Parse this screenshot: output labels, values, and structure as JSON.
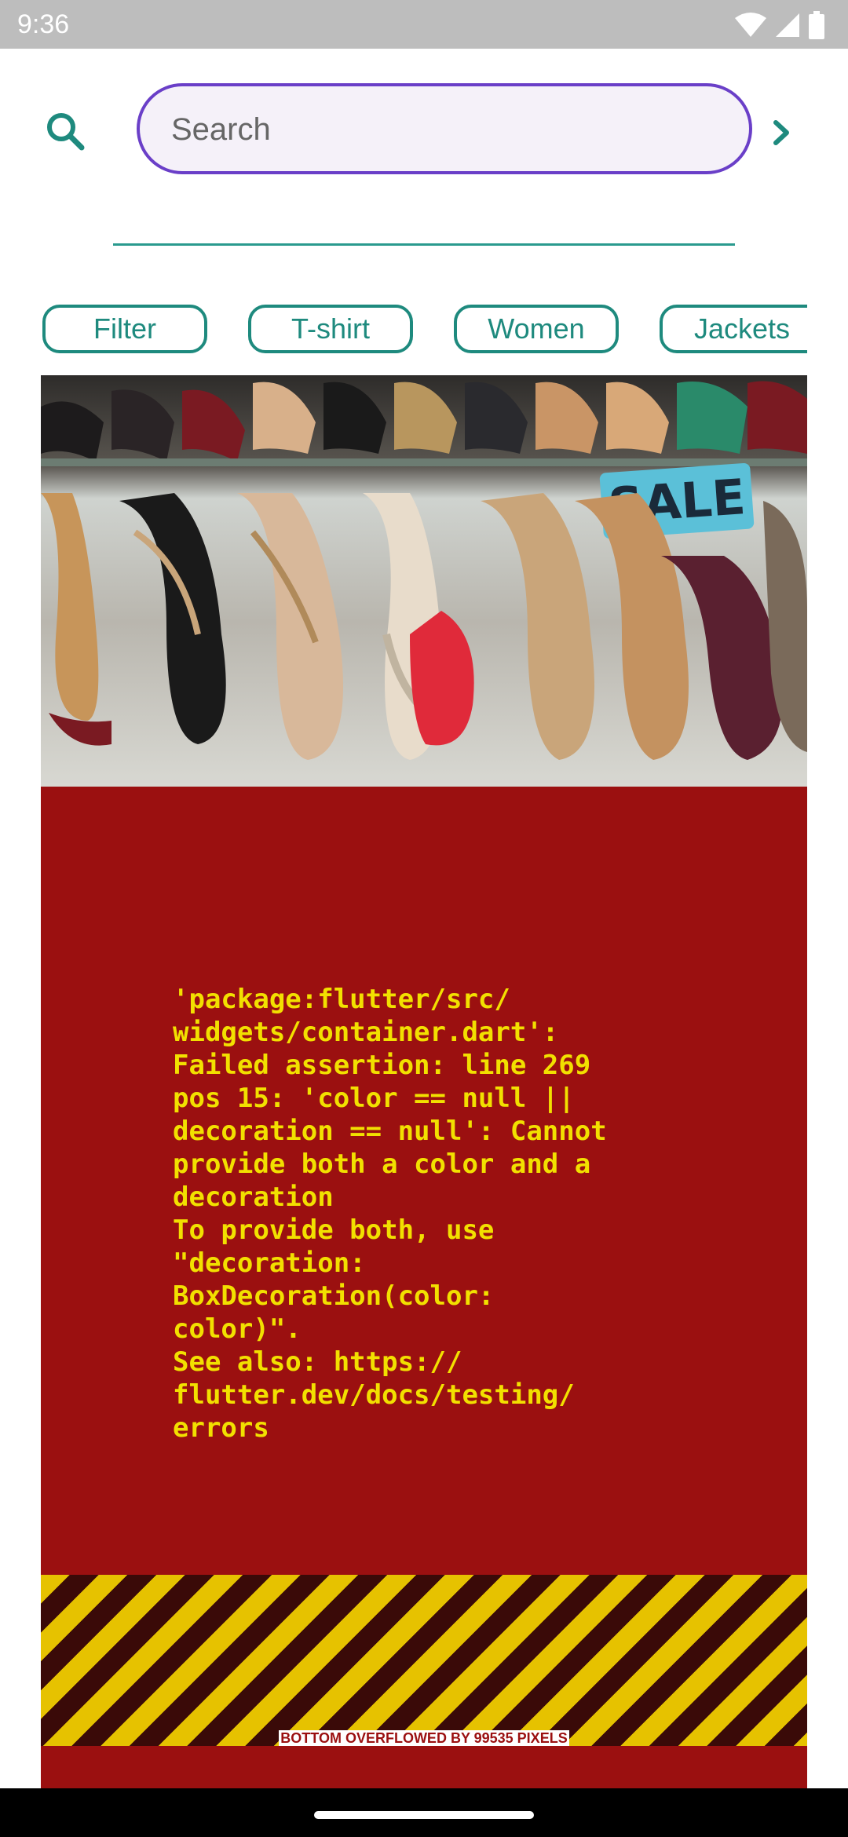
{
  "status_bar": {
    "time": "9:36",
    "icons": [
      "wifi-icon",
      "cellular-icon",
      "battery-icon"
    ]
  },
  "search": {
    "placeholder": "Search",
    "value": "",
    "border_color": "#6a3fc8"
  },
  "chips": [
    {
      "label": "Filter"
    },
    {
      "label": "T-shirt"
    },
    {
      "label": "Women"
    },
    {
      "label": "Jackets"
    }
  ],
  "banner": {
    "sign_text": "SALE"
  },
  "error": {
    "message": "'package:flutter/src/\nwidgets/container.dart':\nFailed assertion: line 269\npos 15: 'color == null ||\ndecoration == null': Cannot\nprovide both a color and a\ndecoration\nTo provide both, use\n\"decoration:\nBoxDecoration(color:\ncolor)\".\nSee also: https://\nflutter.dev/docs/testing/\nerrors",
    "overflow_label": "BOTTOM OVERFLOWED BY 99535 PIXELS"
  },
  "colors": {
    "accent": "#1e8a7e",
    "error_background": "#9b1010",
    "error_text": "#f2e000"
  }
}
